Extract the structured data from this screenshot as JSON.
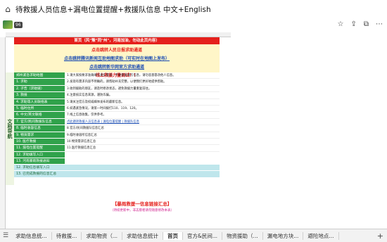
{
  "window": {
    "title": "待救援人员信息+漏电位置提醒+救援队信息 中文+English",
    "badge": "96"
  },
  "sheet": {
    "header": "首页（风\"豫\"同\"州\"，河南加油，勿动此页内容）",
    "banner_lines": [
      "点击跳转人民日报求助通道",
      "点击跳转腾讯新闻互助地图求助（可实时在地图上发布）",
      "点击跳转新华网官方求助通道",
      "线上救援力量调试！！"
    ],
    "side_label": "文档导航",
    "left_items": [
      "郑州紧急求助地图",
      "1. 求助",
      "2. 子告（求助链）",
      "3. 救援",
      "4. 求助等人员联络表",
      "5. 临时住所",
      "6. 中文/英文联络",
      "7. 官方/民间救援队信息",
      "8. 临时收容信息",
      "9. 物资需求",
      "10. 医疗救援",
      "11. 漏电位置提醒",
      "12. 求助填写入口",
      "13. 河南暴雨救援通知"
    ],
    "notes": [
      "1.请大家按要求准确填写真实需求，不要重复填写信息，请勿恶意篡改他人信息。",
      "2.发现有需求内容不明确的，请帮助补充完整，以便我们更好地提供帮助。",
      "3.收到援助的朋友，请及时修改状态，避免救援力量重复前往。",
      "4.注意核实信息来源，谨防诈骗。",
      "5.请关注官方及权威媒体发布的最新信息。",
      "6.如遇紧急情况，请第一时间拨打110、119、120。",
      "7.线上信息收集，仅供参考。",
      "点此跳转救援人员信息表 | 漏电位置提醒 | 救援队信息",
      "8.官方/民间救援队信息汇总",
      "9.临时收容所信息汇总",
      "10.物资需求信息汇总",
      "11.医疗救援信息汇总"
    ],
    "section_rows": [
      "12. 求助信息填写入口",
      "13. 已完成救援的信息汇总"
    ],
    "lower_title": "【暴雨救援一信息链接汇总】",
    "lower_subtitle": "（持续更新中，非志愿者请勿随意修改本表）"
  },
  "tabs": [
    {
      "label": "求助信息统..."
    },
    {
      "label": "待救援..."
    },
    {
      "label": "求助物资（..."
    },
    {
      "label": "求助信息统计"
    },
    {
      "label": "首页"
    },
    {
      "label": "官方&民间..."
    },
    {
      "label": "物资援助（..."
    },
    {
      "label": "漏电地方块..."
    },
    {
      "label": "避险地点..."
    }
  ]
}
